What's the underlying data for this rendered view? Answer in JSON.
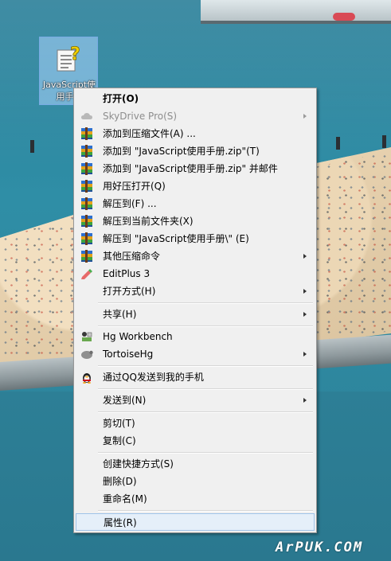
{
  "desktop_icon": {
    "caption": "JavaScript使用手册",
    "icon": "help-document-icon"
  },
  "menu": {
    "items": [
      {
        "label": "打开(O)",
        "icon": "none",
        "bold": true
      },
      {
        "label": "SkyDrive Pro(S)",
        "icon": "cloud-icon",
        "disabled": true,
        "submenu": true
      },
      {
        "label": "添加到压缩文件(A) ...",
        "icon": "winrar-icon"
      },
      {
        "label": "添加到 \"JavaScript使用手册.zip\"(T)",
        "icon": "winrar-icon"
      },
      {
        "label": "添加到 \"JavaScript使用手册.zip\" 并邮件",
        "icon": "winrar-icon"
      },
      {
        "label": "用好压打开(Q)",
        "icon": "winrar-icon"
      },
      {
        "label": "解压到(F) ...",
        "icon": "winrar-icon"
      },
      {
        "label": "解压到当前文件夹(X)",
        "icon": "winrar-icon"
      },
      {
        "label": "解压到 \"JavaScript使用手册\\\" (E)",
        "icon": "winrar-icon"
      },
      {
        "label": "其他压缩命令",
        "icon": "winrar-icon",
        "submenu": true
      },
      {
        "label": "EditPlus 3",
        "icon": "editplus-icon"
      },
      {
        "label": "打开方式(H)",
        "icon": "none",
        "submenu": true
      },
      {
        "label": "共享(H)",
        "icon": "none",
        "submenu": true
      },
      {
        "label": "Hg Workbench",
        "icon": "hg-workbench-icon"
      },
      {
        "label": "TortoiseHg",
        "icon": "tortoisehg-icon",
        "submenu": true
      },
      {
        "label": "通过QQ发送到我的手机",
        "icon": "qq-penguin-icon"
      },
      {
        "label": "发送到(N)",
        "icon": "none",
        "submenu": true
      },
      {
        "label": "剪切(T)",
        "icon": "none"
      },
      {
        "label": "复制(C)",
        "icon": "none"
      },
      {
        "label": "创建快捷方式(S)",
        "icon": "none"
      },
      {
        "label": "删除(D)",
        "icon": "none"
      },
      {
        "label": "重命名(M)",
        "icon": "none"
      },
      {
        "label": "属性(R)",
        "icon": "none",
        "selected": true
      }
    ]
  },
  "watermark": "ArPUK.COM",
  "colors": {
    "menu_bg": "#f0f0f0",
    "selection": "#e5eff9",
    "selection_border": "#9fc3e8",
    "water": "#2f8ea6"
  }
}
